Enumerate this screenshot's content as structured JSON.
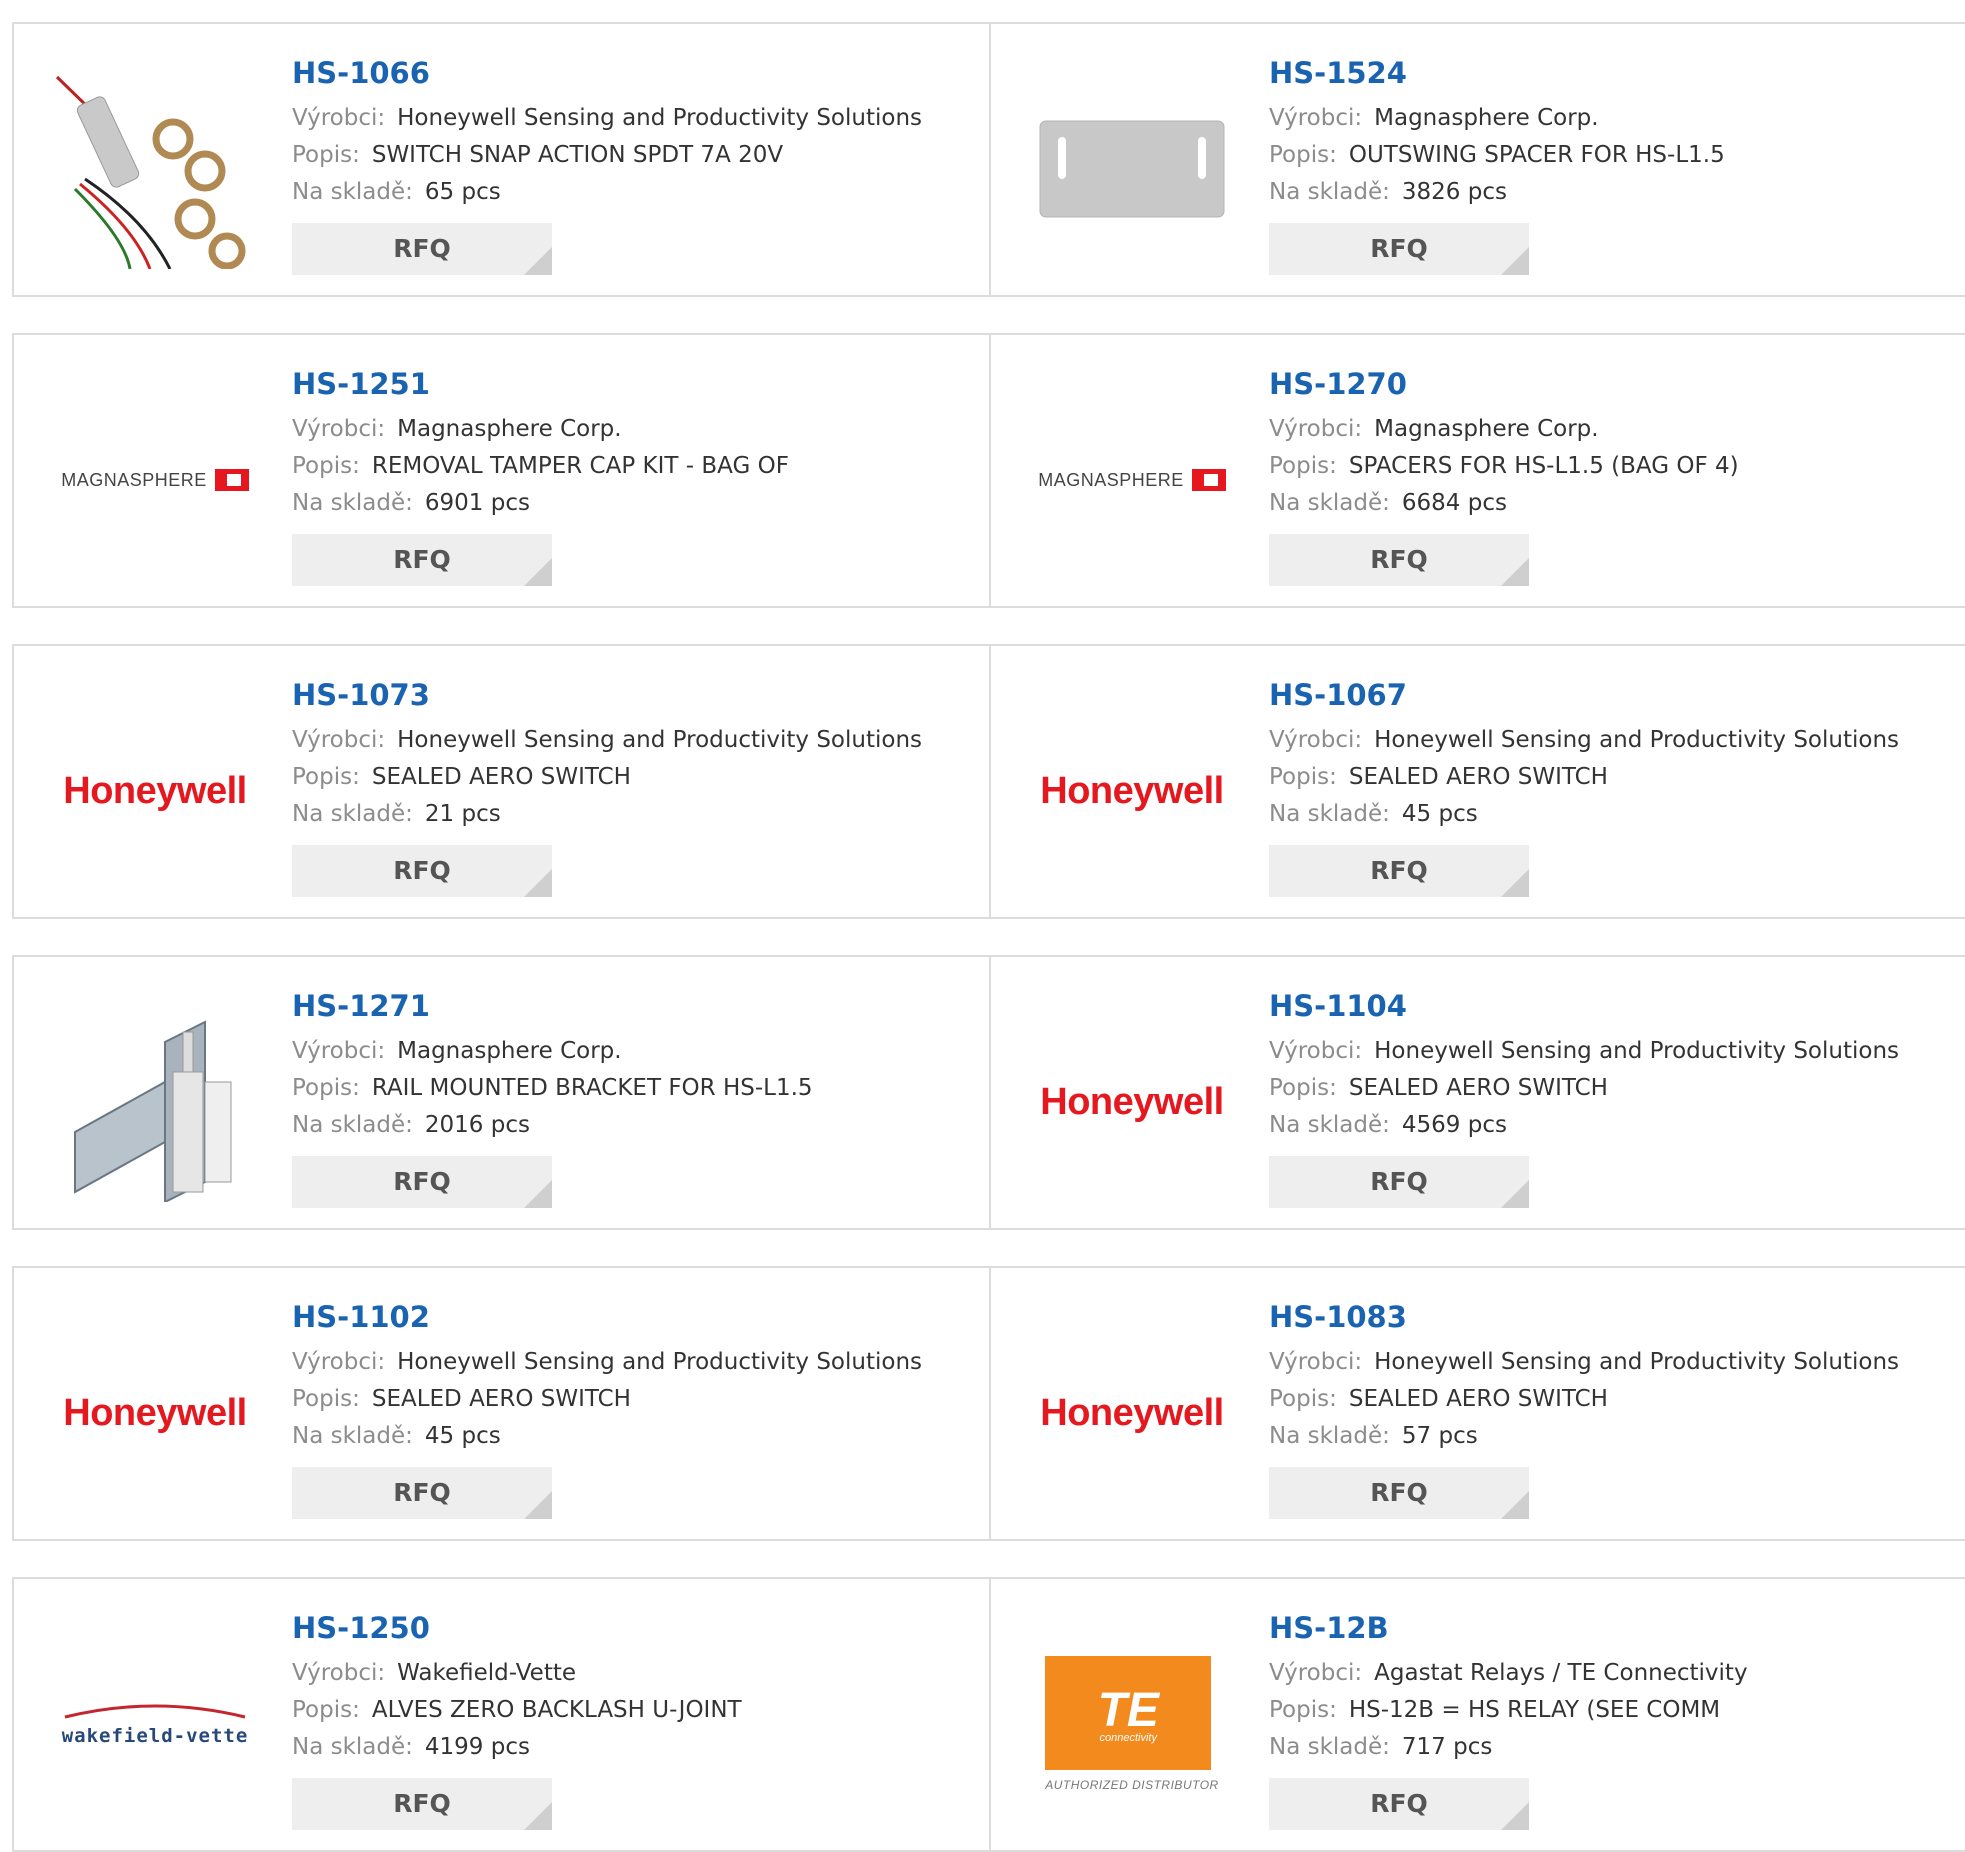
{
  "labels": {
    "manufacturer": "Výrobci:",
    "description": "Popis:",
    "stock": "Na skladě:",
    "rfq": "RFQ"
  },
  "logos": {
    "honeywell": "Honeywell",
    "magnasphere": "MAGNASPHERE",
    "wakefield": "wakefield-vette",
    "te_mark": "TE",
    "te_sub": "connectivity",
    "te_authorized": "AUTHORIZED DISTRIBUTOR"
  },
  "colors": {
    "part_link": "#1a63b0",
    "label": "#8c8c8c",
    "rfq_bg": "#eeeeee",
    "honeywell_red": "#e4181e",
    "te_orange": "#f28a1e"
  },
  "products": [
    {
      "part": "HS-1066",
      "manufacturer": "Honeywell Sensing and Productivity Solutions",
      "description": "SWITCH SNAP ACTION SPDT 7A 20V",
      "stock": "65 pcs",
      "image": "switch-photo"
    },
    {
      "part": "HS-1524",
      "manufacturer": "Magnasphere Corp.",
      "description": "OUTSWING SPACER FOR HS-L1.5",
      "stock": "3826 pcs",
      "image": "spacer-plate-photo"
    },
    {
      "part": "HS-1251",
      "manufacturer": "Magnasphere Corp.",
      "description": "REMOVAL TAMPER CAP KIT - BAG OF",
      "stock": "6901 pcs",
      "image": "magnasphere-logo"
    },
    {
      "part": "HS-1270",
      "manufacturer": "Magnasphere Corp.",
      "description": "SPACERS FOR HS-L1.5 (BAG OF 4)",
      "stock": "6684 pcs",
      "image": "magnasphere-logo"
    },
    {
      "part": "HS-1073",
      "manufacturer": "Honeywell Sensing and Productivity Solutions",
      "description": "SEALED AERO SWITCH",
      "stock": "21 pcs",
      "image": "honeywell-logo"
    },
    {
      "part": "HS-1067",
      "manufacturer": "Honeywell Sensing and Productivity Solutions",
      "description": "SEALED AERO SWITCH",
      "stock": "45 pcs",
      "image": "honeywell-logo"
    },
    {
      "part": "HS-1271",
      "manufacturer": "Magnasphere Corp.",
      "description": "RAIL MOUNTED BRACKET FOR HS-L1.5",
      "stock": "2016 pcs",
      "image": "bracket-photo"
    },
    {
      "part": "HS-1104",
      "manufacturer": "Honeywell Sensing and Productivity Solutions",
      "description": "SEALED AERO SWITCH",
      "stock": "4569 pcs",
      "image": "honeywell-logo"
    },
    {
      "part": "HS-1102",
      "manufacturer": "Honeywell Sensing and Productivity Solutions",
      "description": "SEALED AERO SWITCH",
      "stock": "45 pcs",
      "image": "honeywell-logo"
    },
    {
      "part": "HS-1083",
      "manufacturer": "Honeywell Sensing and Productivity Solutions",
      "description": "SEALED AERO SWITCH",
      "stock": "57 pcs",
      "image": "honeywell-logo"
    },
    {
      "part": "HS-1250",
      "manufacturer": "Wakefield-Vette",
      "description": "ALVES ZERO BACKLASH U-JOINT",
      "stock": "4199 pcs",
      "image": "wakefield-vette-logo"
    },
    {
      "part": "HS-12B",
      "manufacturer": "Agastat Relays / TE Connectivity",
      "description": "HS-12B = HS RELAY (SEE COMM",
      "stock": "717 pcs",
      "image": "te-connectivity-logo"
    }
  ]
}
